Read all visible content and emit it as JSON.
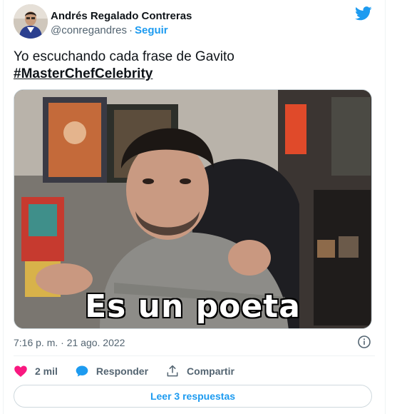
{
  "author": {
    "display_name": "Andrés Regalado Contreras",
    "handle": "@conregandres",
    "separator": "·",
    "follow_label": "Seguir"
  },
  "tweet": {
    "text": "Yo escuchando cada frase de Gavito",
    "hashtag": "#MasterChefCelebrity",
    "media_caption": "Es un poeta",
    "timestamp": "7:16 p. m. · 21 ago. 2022"
  },
  "actions": {
    "like_count": "2 mil",
    "reply_label": "Responder",
    "share_label": "Compartir",
    "read_replies_label": "Leer 3 respuestas"
  },
  "icons": {
    "brand": "twitter-bird-icon",
    "info": "info-icon",
    "like": "heart-icon",
    "reply": "speech-bubble-icon",
    "share": "share-icon"
  },
  "colors": {
    "accent": "#1d9bf0",
    "like": "#f91880",
    "text": "#0f1419",
    "secondary": "#536471"
  }
}
